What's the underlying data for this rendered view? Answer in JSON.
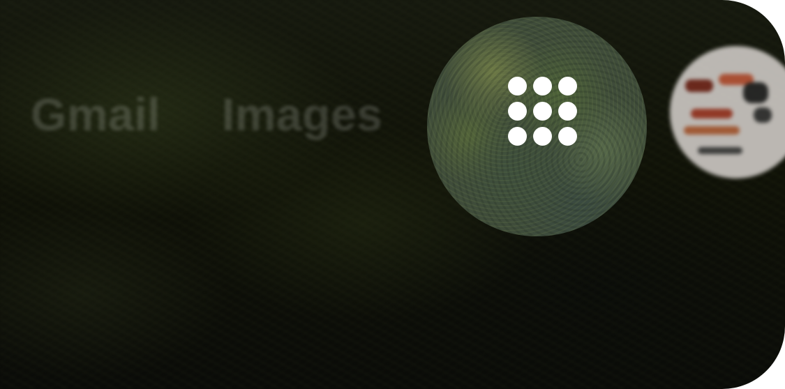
{
  "header": {
    "links": [
      {
        "label": "Gmail"
      },
      {
        "label": "Images"
      }
    ],
    "apps_button": {
      "icon": "apps-grid-icon",
      "dot_color": "#ffffff"
    },
    "avatar": {
      "icon": "profile-avatar"
    }
  },
  "colors": {
    "background": "#0b0c09",
    "link_text": "#c8cdc3"
  }
}
